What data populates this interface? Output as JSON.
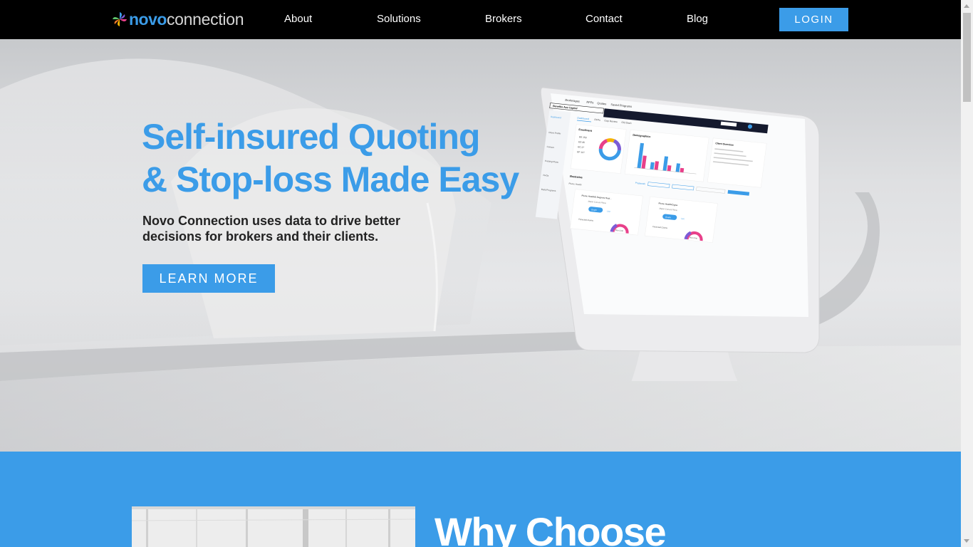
{
  "nav": {
    "logo_bold": "novo",
    "logo_light": "connection",
    "links": [
      "About",
      "Solutions",
      "Brokers",
      "Contact",
      "Blog"
    ],
    "login_label": "LOGIN"
  },
  "hero": {
    "title_line1": "Self-insured Quoting",
    "title_line2": "& Stop-loss Made Easy",
    "subtitle": "Novo Connection uses data to drive better decisions for brokers and their clients.",
    "cta_label": "LEARN MORE"
  },
  "screen": {
    "tabs": [
      "Brokerages",
      "RFPs",
      "Quotes",
      "Saved Programs"
    ],
    "client": "Benefits Ave Capital",
    "subtabs": [
      "Dashboard",
      "RFPs",
      "Gap Review",
      "Old Dash"
    ],
    "sidebar": [
      "Dashboard",
      "Client Profile",
      "Census",
      "Existing Plans",
      "FHOs",
      "Build Programs"
    ],
    "enrollment_title": "Enrollment",
    "enrollment_rows": [
      "EE 153",
      "ES 45",
      "EC 27",
      "EF 127"
    ],
    "demographics_title": "Demographics",
    "client_overview_title": "Client Overview",
    "illustrative_title": "Illustrative",
    "proposals_label": "Proposals",
    "plume_label": "Plume Health",
    "card1_title": "Plume Health/5 Degrees Heal...",
    "card2_title": "Plume Health/Cigna",
    "match_label": "Match Current Plans",
    "graph_label": "Graph",
    "list_label": "List",
    "expected_label": "Expected Claims",
    "maxcost_label": "Max Cost"
  },
  "section2": {
    "heading": "Why Choose"
  },
  "colors": {
    "accent": "#3b9ce8",
    "nav_bg": "#000000"
  }
}
